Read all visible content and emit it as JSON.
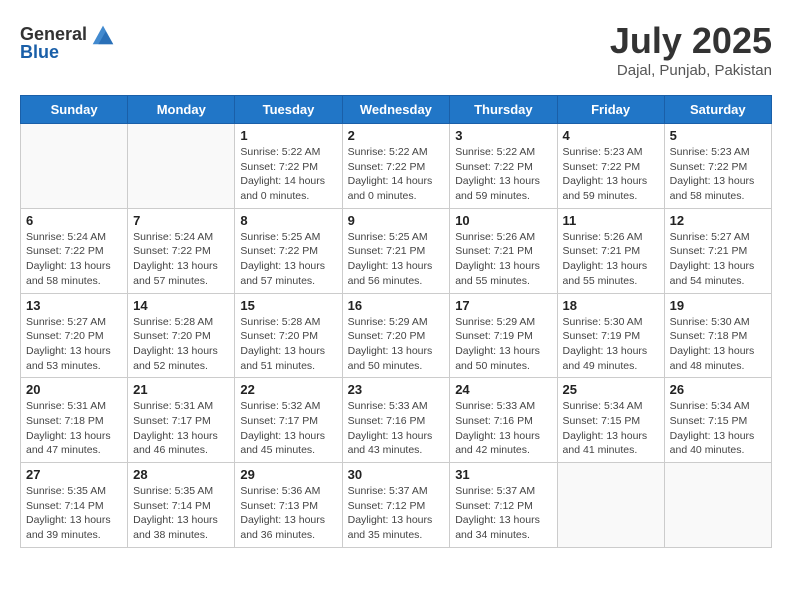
{
  "header": {
    "logo_general": "General",
    "logo_blue": "Blue",
    "month_year": "July 2025",
    "location": "Dajal, Punjab, Pakistan"
  },
  "days_of_week": [
    "Sunday",
    "Monday",
    "Tuesday",
    "Wednesday",
    "Thursday",
    "Friday",
    "Saturday"
  ],
  "weeks": [
    [
      {
        "day": "",
        "sunrise": "",
        "sunset": "",
        "daylight": ""
      },
      {
        "day": "",
        "sunrise": "",
        "sunset": "",
        "daylight": ""
      },
      {
        "day": "1",
        "sunrise": "Sunrise: 5:22 AM",
        "sunset": "Sunset: 7:22 PM",
        "daylight": "Daylight: 14 hours and 0 minutes."
      },
      {
        "day": "2",
        "sunrise": "Sunrise: 5:22 AM",
        "sunset": "Sunset: 7:22 PM",
        "daylight": "Daylight: 14 hours and 0 minutes."
      },
      {
        "day": "3",
        "sunrise": "Sunrise: 5:22 AM",
        "sunset": "Sunset: 7:22 PM",
        "daylight": "Daylight: 13 hours and 59 minutes."
      },
      {
        "day": "4",
        "sunrise": "Sunrise: 5:23 AM",
        "sunset": "Sunset: 7:22 PM",
        "daylight": "Daylight: 13 hours and 59 minutes."
      },
      {
        "day": "5",
        "sunrise": "Sunrise: 5:23 AM",
        "sunset": "Sunset: 7:22 PM",
        "daylight": "Daylight: 13 hours and 58 minutes."
      }
    ],
    [
      {
        "day": "6",
        "sunrise": "Sunrise: 5:24 AM",
        "sunset": "Sunset: 7:22 PM",
        "daylight": "Daylight: 13 hours and 58 minutes."
      },
      {
        "day": "7",
        "sunrise": "Sunrise: 5:24 AM",
        "sunset": "Sunset: 7:22 PM",
        "daylight": "Daylight: 13 hours and 57 minutes."
      },
      {
        "day": "8",
        "sunrise": "Sunrise: 5:25 AM",
        "sunset": "Sunset: 7:22 PM",
        "daylight": "Daylight: 13 hours and 57 minutes."
      },
      {
        "day": "9",
        "sunrise": "Sunrise: 5:25 AM",
        "sunset": "Sunset: 7:21 PM",
        "daylight": "Daylight: 13 hours and 56 minutes."
      },
      {
        "day": "10",
        "sunrise": "Sunrise: 5:26 AM",
        "sunset": "Sunset: 7:21 PM",
        "daylight": "Daylight: 13 hours and 55 minutes."
      },
      {
        "day": "11",
        "sunrise": "Sunrise: 5:26 AM",
        "sunset": "Sunset: 7:21 PM",
        "daylight": "Daylight: 13 hours and 55 minutes."
      },
      {
        "day": "12",
        "sunrise": "Sunrise: 5:27 AM",
        "sunset": "Sunset: 7:21 PM",
        "daylight": "Daylight: 13 hours and 54 minutes."
      }
    ],
    [
      {
        "day": "13",
        "sunrise": "Sunrise: 5:27 AM",
        "sunset": "Sunset: 7:20 PM",
        "daylight": "Daylight: 13 hours and 53 minutes."
      },
      {
        "day": "14",
        "sunrise": "Sunrise: 5:28 AM",
        "sunset": "Sunset: 7:20 PM",
        "daylight": "Daylight: 13 hours and 52 minutes."
      },
      {
        "day": "15",
        "sunrise": "Sunrise: 5:28 AM",
        "sunset": "Sunset: 7:20 PM",
        "daylight": "Daylight: 13 hours and 51 minutes."
      },
      {
        "day": "16",
        "sunrise": "Sunrise: 5:29 AM",
        "sunset": "Sunset: 7:20 PM",
        "daylight": "Daylight: 13 hours and 50 minutes."
      },
      {
        "day": "17",
        "sunrise": "Sunrise: 5:29 AM",
        "sunset": "Sunset: 7:19 PM",
        "daylight": "Daylight: 13 hours and 50 minutes."
      },
      {
        "day": "18",
        "sunrise": "Sunrise: 5:30 AM",
        "sunset": "Sunset: 7:19 PM",
        "daylight": "Daylight: 13 hours and 49 minutes."
      },
      {
        "day": "19",
        "sunrise": "Sunrise: 5:30 AM",
        "sunset": "Sunset: 7:18 PM",
        "daylight": "Daylight: 13 hours and 48 minutes."
      }
    ],
    [
      {
        "day": "20",
        "sunrise": "Sunrise: 5:31 AM",
        "sunset": "Sunset: 7:18 PM",
        "daylight": "Daylight: 13 hours and 47 minutes."
      },
      {
        "day": "21",
        "sunrise": "Sunrise: 5:31 AM",
        "sunset": "Sunset: 7:17 PM",
        "daylight": "Daylight: 13 hours and 46 minutes."
      },
      {
        "day": "22",
        "sunrise": "Sunrise: 5:32 AM",
        "sunset": "Sunset: 7:17 PM",
        "daylight": "Daylight: 13 hours and 45 minutes."
      },
      {
        "day": "23",
        "sunrise": "Sunrise: 5:33 AM",
        "sunset": "Sunset: 7:16 PM",
        "daylight": "Daylight: 13 hours and 43 minutes."
      },
      {
        "day": "24",
        "sunrise": "Sunrise: 5:33 AM",
        "sunset": "Sunset: 7:16 PM",
        "daylight": "Daylight: 13 hours and 42 minutes."
      },
      {
        "day": "25",
        "sunrise": "Sunrise: 5:34 AM",
        "sunset": "Sunset: 7:15 PM",
        "daylight": "Daylight: 13 hours and 41 minutes."
      },
      {
        "day": "26",
        "sunrise": "Sunrise: 5:34 AM",
        "sunset": "Sunset: 7:15 PM",
        "daylight": "Daylight: 13 hours and 40 minutes."
      }
    ],
    [
      {
        "day": "27",
        "sunrise": "Sunrise: 5:35 AM",
        "sunset": "Sunset: 7:14 PM",
        "daylight": "Daylight: 13 hours and 39 minutes."
      },
      {
        "day": "28",
        "sunrise": "Sunrise: 5:35 AM",
        "sunset": "Sunset: 7:14 PM",
        "daylight": "Daylight: 13 hours and 38 minutes."
      },
      {
        "day": "29",
        "sunrise": "Sunrise: 5:36 AM",
        "sunset": "Sunset: 7:13 PM",
        "daylight": "Daylight: 13 hours and 36 minutes."
      },
      {
        "day": "30",
        "sunrise": "Sunrise: 5:37 AM",
        "sunset": "Sunset: 7:12 PM",
        "daylight": "Daylight: 13 hours and 35 minutes."
      },
      {
        "day": "31",
        "sunrise": "Sunrise: 5:37 AM",
        "sunset": "Sunset: 7:12 PM",
        "daylight": "Daylight: 13 hours and 34 minutes."
      },
      {
        "day": "",
        "sunrise": "",
        "sunset": "",
        "daylight": ""
      },
      {
        "day": "",
        "sunrise": "",
        "sunset": "",
        "daylight": ""
      }
    ]
  ]
}
